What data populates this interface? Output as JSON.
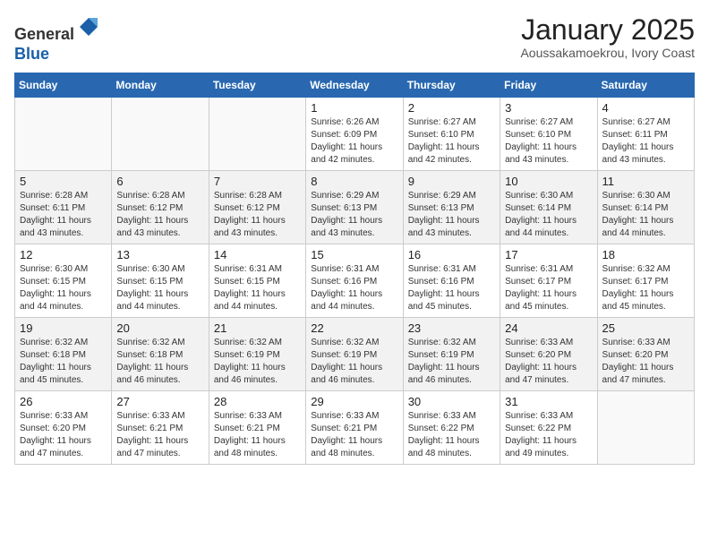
{
  "header": {
    "logo_line1": "General",
    "logo_line2": "Blue",
    "month_title": "January 2025",
    "location": "Aoussakamoekrou, Ivory Coast"
  },
  "weekdays": [
    "Sunday",
    "Monday",
    "Tuesday",
    "Wednesday",
    "Thursday",
    "Friday",
    "Saturday"
  ],
  "weeks": [
    [
      {
        "day": null,
        "info": null
      },
      {
        "day": null,
        "info": null
      },
      {
        "day": null,
        "info": null
      },
      {
        "day": "1",
        "info": "Sunrise: 6:26 AM\nSunset: 6:09 PM\nDaylight: 11 hours and 42 minutes."
      },
      {
        "day": "2",
        "info": "Sunrise: 6:27 AM\nSunset: 6:10 PM\nDaylight: 11 hours and 42 minutes."
      },
      {
        "day": "3",
        "info": "Sunrise: 6:27 AM\nSunset: 6:10 PM\nDaylight: 11 hours and 43 minutes."
      },
      {
        "day": "4",
        "info": "Sunrise: 6:27 AM\nSunset: 6:11 PM\nDaylight: 11 hours and 43 minutes."
      }
    ],
    [
      {
        "day": "5",
        "info": "Sunrise: 6:28 AM\nSunset: 6:11 PM\nDaylight: 11 hours and 43 minutes."
      },
      {
        "day": "6",
        "info": "Sunrise: 6:28 AM\nSunset: 6:12 PM\nDaylight: 11 hours and 43 minutes."
      },
      {
        "day": "7",
        "info": "Sunrise: 6:28 AM\nSunset: 6:12 PM\nDaylight: 11 hours and 43 minutes."
      },
      {
        "day": "8",
        "info": "Sunrise: 6:29 AM\nSunset: 6:13 PM\nDaylight: 11 hours and 43 minutes."
      },
      {
        "day": "9",
        "info": "Sunrise: 6:29 AM\nSunset: 6:13 PM\nDaylight: 11 hours and 43 minutes."
      },
      {
        "day": "10",
        "info": "Sunrise: 6:30 AM\nSunset: 6:14 PM\nDaylight: 11 hours and 44 minutes."
      },
      {
        "day": "11",
        "info": "Sunrise: 6:30 AM\nSunset: 6:14 PM\nDaylight: 11 hours and 44 minutes."
      }
    ],
    [
      {
        "day": "12",
        "info": "Sunrise: 6:30 AM\nSunset: 6:15 PM\nDaylight: 11 hours and 44 minutes."
      },
      {
        "day": "13",
        "info": "Sunrise: 6:30 AM\nSunset: 6:15 PM\nDaylight: 11 hours and 44 minutes."
      },
      {
        "day": "14",
        "info": "Sunrise: 6:31 AM\nSunset: 6:15 PM\nDaylight: 11 hours and 44 minutes."
      },
      {
        "day": "15",
        "info": "Sunrise: 6:31 AM\nSunset: 6:16 PM\nDaylight: 11 hours and 44 minutes."
      },
      {
        "day": "16",
        "info": "Sunrise: 6:31 AM\nSunset: 6:16 PM\nDaylight: 11 hours and 45 minutes."
      },
      {
        "day": "17",
        "info": "Sunrise: 6:31 AM\nSunset: 6:17 PM\nDaylight: 11 hours and 45 minutes."
      },
      {
        "day": "18",
        "info": "Sunrise: 6:32 AM\nSunset: 6:17 PM\nDaylight: 11 hours and 45 minutes."
      }
    ],
    [
      {
        "day": "19",
        "info": "Sunrise: 6:32 AM\nSunset: 6:18 PM\nDaylight: 11 hours and 45 minutes."
      },
      {
        "day": "20",
        "info": "Sunrise: 6:32 AM\nSunset: 6:18 PM\nDaylight: 11 hours and 46 minutes."
      },
      {
        "day": "21",
        "info": "Sunrise: 6:32 AM\nSunset: 6:19 PM\nDaylight: 11 hours and 46 minutes."
      },
      {
        "day": "22",
        "info": "Sunrise: 6:32 AM\nSunset: 6:19 PM\nDaylight: 11 hours and 46 minutes."
      },
      {
        "day": "23",
        "info": "Sunrise: 6:32 AM\nSunset: 6:19 PM\nDaylight: 11 hours and 46 minutes."
      },
      {
        "day": "24",
        "info": "Sunrise: 6:33 AM\nSunset: 6:20 PM\nDaylight: 11 hours and 47 minutes."
      },
      {
        "day": "25",
        "info": "Sunrise: 6:33 AM\nSunset: 6:20 PM\nDaylight: 11 hours and 47 minutes."
      }
    ],
    [
      {
        "day": "26",
        "info": "Sunrise: 6:33 AM\nSunset: 6:20 PM\nDaylight: 11 hours and 47 minutes."
      },
      {
        "day": "27",
        "info": "Sunrise: 6:33 AM\nSunset: 6:21 PM\nDaylight: 11 hours and 47 minutes."
      },
      {
        "day": "28",
        "info": "Sunrise: 6:33 AM\nSunset: 6:21 PM\nDaylight: 11 hours and 48 minutes."
      },
      {
        "day": "29",
        "info": "Sunrise: 6:33 AM\nSunset: 6:21 PM\nDaylight: 11 hours and 48 minutes."
      },
      {
        "day": "30",
        "info": "Sunrise: 6:33 AM\nSunset: 6:22 PM\nDaylight: 11 hours and 48 minutes."
      },
      {
        "day": "31",
        "info": "Sunrise: 6:33 AM\nSunset: 6:22 PM\nDaylight: 11 hours and 49 minutes."
      },
      {
        "day": null,
        "info": null
      }
    ]
  ]
}
